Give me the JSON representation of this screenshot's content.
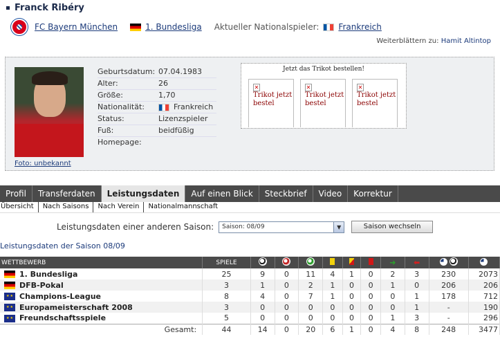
{
  "player": {
    "name": "Franck Ribéry",
    "club": "FC Bayern München",
    "league": "1. Bundesliga",
    "national_label": "Aktueller Nationalspieler:",
    "national_team": "Frankreich",
    "next_label": "Weiterblättern zu:",
    "next_name": "Hamit Altintop",
    "photo_credit": "Foto: unbekannt"
  },
  "details": [
    {
      "label": "Geburtsdatum:",
      "value": "07.04.1983"
    },
    {
      "label": "Alter:",
      "value": "26"
    },
    {
      "label": "Größe:",
      "value": "1,70"
    },
    {
      "label": "Nationalität:",
      "value": "Frankreich",
      "flag": "fr"
    },
    {
      "label": "Status:",
      "value": "Lizenzspieler"
    },
    {
      "label": "Fuß:",
      "value": "beidfüßig"
    },
    {
      "label": "Homepage:",
      "value": ""
    }
  ],
  "trikot": {
    "header": "Jetzt das Trikot bestellen!",
    "items": [
      "Trikot jetzt bestel",
      "Trikot jetzt bestel",
      "Trikot jetzt bestel"
    ]
  },
  "tabs": [
    "Profil",
    "Transferdaten",
    "Leistungsdaten",
    "Auf einen Blick",
    "Steckbrief",
    "Video",
    "Korrektur"
  ],
  "active_tab": "Leistungsdaten",
  "subtabs": [
    "Übersicht",
    "Nach Saisons",
    "Nach Verein",
    "Nationalmannschaft"
  ],
  "season": {
    "label": "Leistungsdaten einer anderen Saison:",
    "selected": "Saison: 08/09",
    "button": "Saison wechseln",
    "title": "Leistungsdaten der Saison 08/09"
  },
  "stats": {
    "headers": [
      "WETTBEWERB",
      "SPIELE"
    ],
    "rows": [
      {
        "flag": "de",
        "comp": "1. Bundesliga",
        "vals": [
          "25",
          "9",
          "0",
          "11",
          "4",
          "1",
          "0",
          "2",
          "3",
          "230",
          "2073"
        ]
      },
      {
        "flag": "de",
        "comp": "DFB-Pokal",
        "vals": [
          "3",
          "1",
          "0",
          "2",
          "1",
          "0",
          "0",
          "1",
          "0",
          "206",
          "206"
        ]
      },
      {
        "flag": "eu",
        "comp": "Champions-League",
        "vals": [
          "8",
          "4",
          "0",
          "7",
          "1",
          "0",
          "0",
          "0",
          "1",
          "178",
          "712"
        ]
      },
      {
        "flag": "eu",
        "comp": "Europameisterschaft 2008",
        "vals": [
          "3",
          "0",
          "0",
          "0",
          "0",
          "0",
          "0",
          "0",
          "1",
          "-",
          "190"
        ]
      },
      {
        "flag": "eu",
        "comp": "Freundschaftsspiele",
        "vals": [
          "5",
          "0",
          "0",
          "0",
          "0",
          "0",
          "0",
          "1",
          "3",
          "-",
          "296"
        ]
      }
    ],
    "total_label": "Gesamt:",
    "totals": [
      "44",
      "14",
      "0",
      "20",
      "6",
      "1",
      "0",
      "4",
      "8",
      "248",
      "3477"
    ]
  }
}
